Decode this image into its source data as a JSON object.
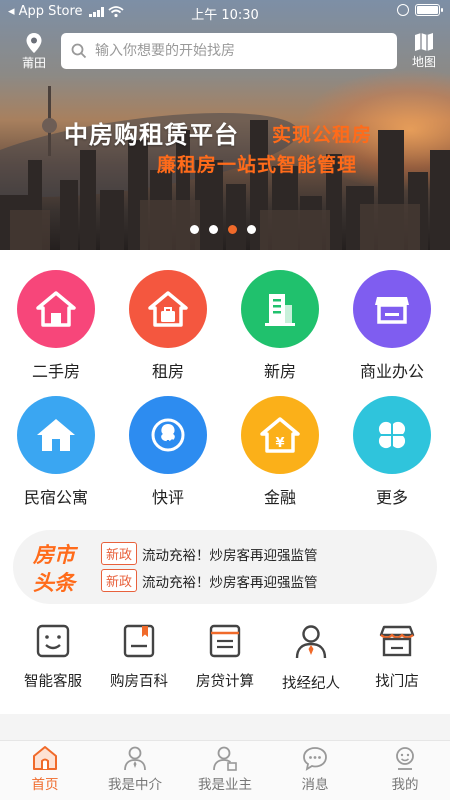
{
  "status": {
    "carrier": "◂ App Store",
    "time": "上午 10:30"
  },
  "header": {
    "location_label": "莆田",
    "search_placeholder": "输入你想要的开始找房",
    "map_label": "地图"
  },
  "banner": {
    "slogan_main": "中房购租赁平台",
    "slogan_accent": "实现公租房",
    "slogan_sub": "廉租房一站式智能管理",
    "slide_count": 4,
    "active_slide": 3
  },
  "categories": [
    {
      "label": "二手房",
      "icon": "house-icon",
      "color": "#f7467a"
    },
    {
      "label": "租房",
      "icon": "house-bag-icon",
      "color": "#f4573f"
    },
    {
      "label": "新房",
      "icon": "building-icon",
      "color": "#20c16d"
    },
    {
      "label": "商业办公",
      "icon": "store-icon",
      "color": "#7f5df0"
    },
    {
      "label": "民宿公寓",
      "icon": "home-icon",
      "color": "#3aa6f2"
    },
    {
      "label": "快评",
      "icon": "tree-icon",
      "color": "#2d8cf0"
    },
    {
      "label": "金融",
      "icon": "money-house-icon",
      "color": "#fbb019"
    },
    {
      "label": "更多",
      "icon": "clover-icon",
      "color": "#2fc4dc"
    }
  ],
  "headlines": {
    "logo_line1": "房市",
    "logo_line2": "头条",
    "items": [
      {
        "tag": "新政",
        "text": "流动充裕！炒房客再迎强监管"
      },
      {
        "tag": "新政",
        "text": "流动充裕！炒房客再迎强监管"
      }
    ]
  },
  "services": [
    {
      "label": "智能客服",
      "icon": "smile-icon"
    },
    {
      "label": "购房百科",
      "icon": "book-icon"
    },
    {
      "label": "房贷计算",
      "icon": "calculator-icon"
    },
    {
      "label": "找经纪人",
      "icon": "agent-icon"
    },
    {
      "label": "找门店",
      "icon": "shop-icon"
    }
  ],
  "tabs": [
    {
      "label": "首页",
      "icon": "home-tab-icon",
      "active": true
    },
    {
      "label": "我是中介",
      "icon": "agent-tab-icon",
      "active": false
    },
    {
      "label": "我是业主",
      "icon": "owner-tab-icon",
      "active": false
    },
    {
      "label": "消息",
      "icon": "message-tab-icon",
      "active": false
    },
    {
      "label": "我的",
      "icon": "profile-tab-icon",
      "active": false
    }
  ],
  "colors": {
    "accent": "#f06a2a",
    "slogan_accent": "#ff6b1a"
  }
}
